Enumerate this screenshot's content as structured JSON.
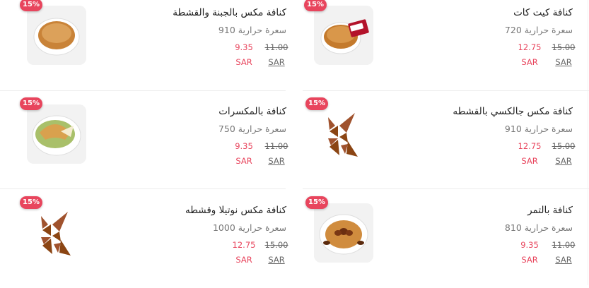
{
  "accent_color": "#e8455d",
  "items": [
    {
      "name": "كنافة كيت كات",
      "calories": "سعرة حرارية 720",
      "old_price": "15.00",
      "new_price": "12.75",
      "currency": "SAR",
      "discount": "15%",
      "image": "kitkat-kunafa"
    },
    {
      "name": "كنافة مكس بالجبنة والقشطة",
      "calories": "سعرة حرارية 910",
      "old_price": "11.00",
      "new_price": "9.35",
      "currency": "SAR",
      "discount": "15%",
      "image": "cheese-cream-kunafa"
    },
    {
      "name": "كنافة مكس جالكسي بالقشطه",
      "calories": "سعرة حرارية 910",
      "old_price": "15.00",
      "new_price": "12.75",
      "currency": "SAR",
      "discount": "15%",
      "image": "brand-logo"
    },
    {
      "name": "كنافة بالمكسرات",
      "calories": "سعرة حرارية 750",
      "old_price": "11.00",
      "new_price": "9.35",
      "currency": "SAR",
      "discount": "15%",
      "image": "nuts-kunafa"
    },
    {
      "name": "كنافة بالتمر",
      "calories": "سعرة حرارية 810",
      "old_price": "11.00",
      "new_price": "9.35",
      "currency": "SAR",
      "discount": "15%",
      "image": "dates-kunafa"
    },
    {
      "name": "كنافة مكس نوتيلا وقشطه",
      "calories": "سعرة حرارية 1000",
      "old_price": "15.00",
      "new_price": "12.75",
      "currency": "SAR",
      "discount": "15%",
      "image": "brand-logo"
    }
  ]
}
